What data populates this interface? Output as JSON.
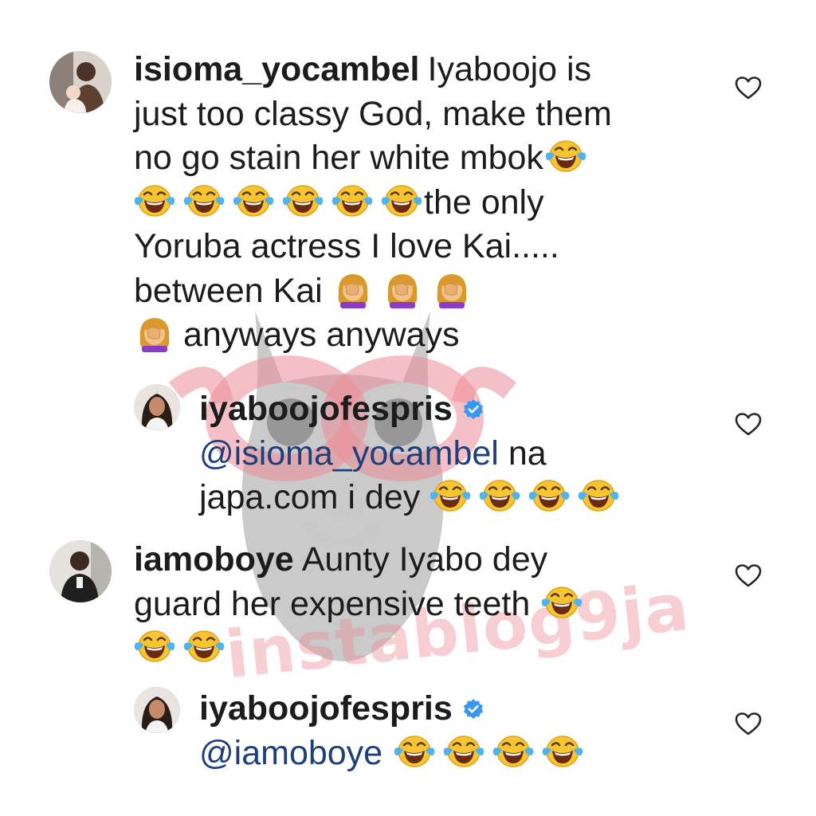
{
  "watermark": {
    "text": "instablog9ja"
  },
  "comments": [
    {
      "username": "isioma_yocambel",
      "line1": "Iyaboojo is",
      "line2": "just too classy God, make them",
      "line3": "no go stain her white mbok",
      "line4_text": "the only",
      "line5": "Yoruba actress I love Kai.....",
      "line6": "between Kai",
      "line7_text": "anyways anyways",
      "liked": false
    },
    {
      "username": "iyaboojofespris",
      "verified": true,
      "mention": "@isioma_yocambel",
      "text1": "na",
      "text2": "japa.com i dey",
      "liked": false
    },
    {
      "username": "iamoboye",
      "line1": "Aunty Iyabo dey",
      "line2": "guard her expensive teeth",
      "liked": false
    },
    {
      "username": "iyaboojofespris",
      "verified": true,
      "mention": "@iamoboye",
      "liked": false
    }
  ],
  "icons": {
    "like": "heart-outline-icon",
    "laugh": "face-with-tears-of-joy-emoji",
    "facepalm": "woman-facepalming-emoji",
    "verified": "verified-badge-icon"
  },
  "colors": {
    "text": "#1c1c1c",
    "mention": "#1f3f7a",
    "verified": "#3897f0",
    "watermark": "#ec8c96"
  }
}
